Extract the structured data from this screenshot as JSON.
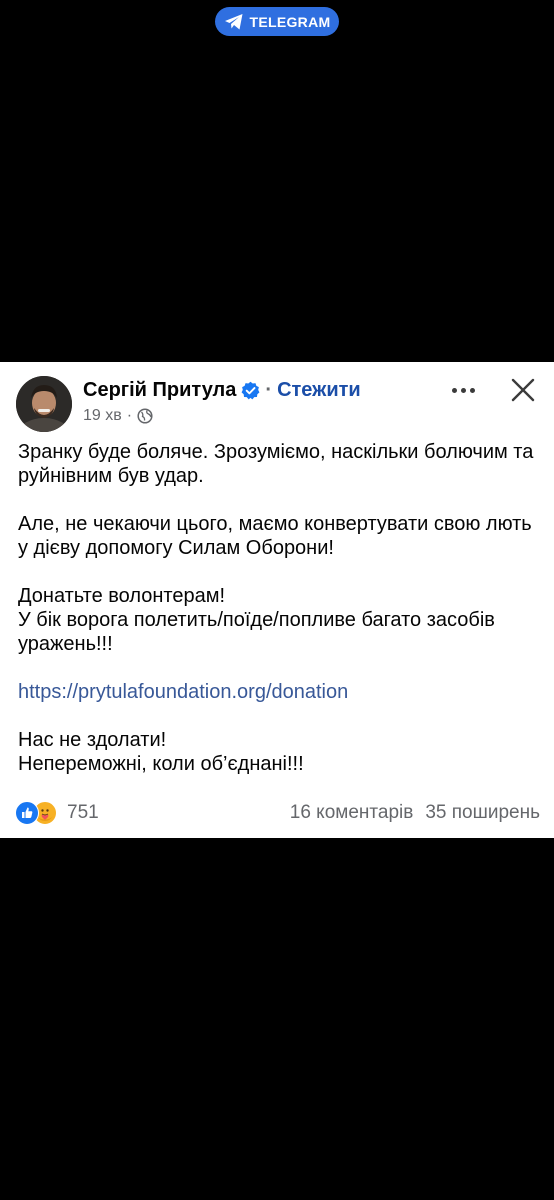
{
  "telegram_badge": {
    "label": "TELEGRAM"
  },
  "post": {
    "author": "Сергій Притула",
    "follow_label": "Стежити",
    "separator": "·",
    "time": "19 хв",
    "paragraphs": [
      "Зранку буде боляче. Зрозуміємо, наскільки болючим та руйнівним був удар.",
      "Але, не чекаючи цього, маємо конвертувати свою лють у дієву допомогу Силам Оборони!",
      "Донатьте волонтерам!",
      "У бік ворога полетить/поїде/попливе багато засобів уражень!!!",
      "https://prytulafoundation.org/donation",
      "Нас не здолати!",
      "Непереможні, коли об’єднані!!!"
    ],
    "reaction_count": "751",
    "comments": "16 коментарів",
    "shares": "35 поширень"
  },
  "colors": {
    "background": "#000000",
    "card": "#ffffff",
    "telegram_badge": "#2f6fe0",
    "link": "#385898",
    "follow": "#1b4ea8",
    "verified": "#1877f2",
    "meta_text": "#65676b"
  },
  "icons": [
    "telegram-plane-icon",
    "verified-badge-icon",
    "globe-icon",
    "more-icon",
    "close-icon",
    "like-reaction-icon",
    "care-reaction-icon"
  ]
}
